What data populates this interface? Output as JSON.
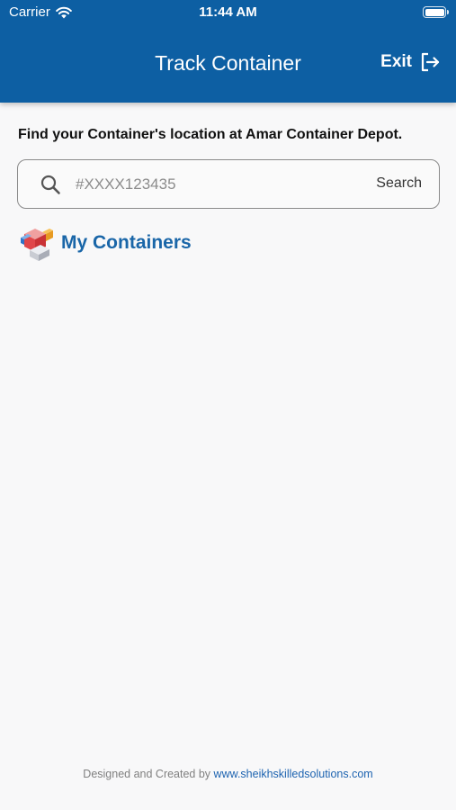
{
  "status_bar": {
    "carrier": "Carrier",
    "time": "11:44 AM",
    "icons": [
      "wifi-icon",
      "battery-icon"
    ]
  },
  "header": {
    "title": "Track Container",
    "exit_label": "Exit",
    "exit_icon": "exit-icon",
    "background_color": "#0d5fa3"
  },
  "main": {
    "instruction": "Find your Container's location at Amar Container Depot.",
    "search": {
      "placeholder": "#XXXX123435",
      "value": "",
      "button_label": "Search",
      "icon": "search-icon"
    },
    "section": {
      "title": "My Containers",
      "icon": "containers-icon",
      "title_color": "#1a66a8"
    }
  },
  "footer": {
    "prefix": "Designed and Created by",
    "link": "www.sheikhskilledsolutions.com",
    "link_color": "#1d63b0"
  }
}
